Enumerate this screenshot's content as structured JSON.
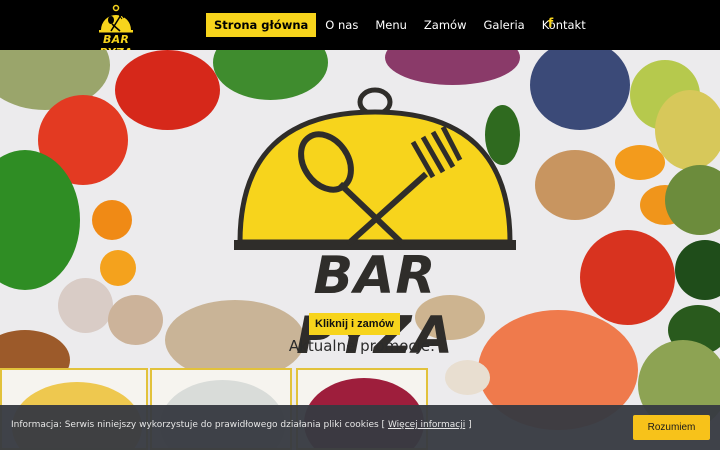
{
  "header": {
    "logo_text": "BAR PYZA",
    "nav": [
      {
        "label": "Strona główna",
        "active": true
      },
      {
        "label": "O nas",
        "active": false
      },
      {
        "label": "Menu",
        "active": false
      },
      {
        "label": "Zamów",
        "active": false
      },
      {
        "label": "Galeria",
        "active": false
      },
      {
        "label": "Kontakt",
        "active": false
      }
    ],
    "facebook_icon": "f"
  },
  "hero": {
    "brand_text": "BAR PYZA",
    "cta_label": "Kliknij i zamów",
    "promo_heading": "Aktualne promocje:"
  },
  "cookie": {
    "text_prefix": "Informacja: Serwis niniejszy wykorzystuje do prawidłowego działania pliki cookies [",
    "link_label": "Więcej informacji",
    "text_suffix": "]",
    "accept_label": "Rozumiem"
  },
  "colors": {
    "accent": "#f7d41c",
    "header_bg": "#000000",
    "cookie_bg": "#373a42",
    "cookie_button": "#f7c21a"
  }
}
